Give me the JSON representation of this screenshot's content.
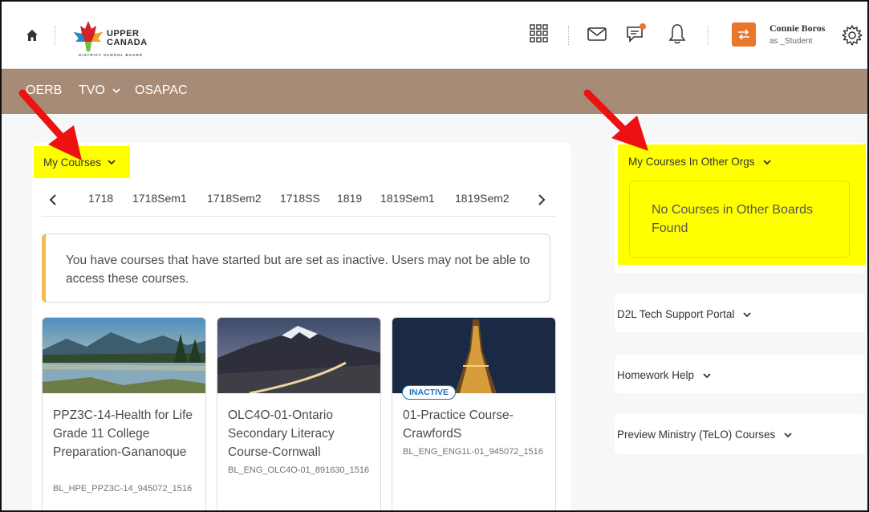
{
  "header": {
    "logo_line1": "UPPER",
    "logo_line2": "CANADA",
    "logo_line3": "DISTRICT SCHOOL BOARD",
    "user_name": "Connie Boros",
    "user_role": "as _Student",
    "icons": [
      "home-icon",
      "apps-grid-icon",
      "mail-icon",
      "chat-icon",
      "bell-icon",
      "impersonate-icon",
      "gear-icon"
    ],
    "chat_badge_color": "#e8762b"
  },
  "nav": {
    "items": [
      "OERB",
      "TVO",
      "OSAPAC"
    ],
    "bg_color": "#a68b76"
  },
  "my_courses": {
    "title": "My Courses",
    "tabs": [
      "1718",
      "1718Sem1",
      "1718Sem2",
      "1718SS",
      "1819",
      "1819Sem1",
      "1819Sem2"
    ],
    "alert": "You have courses that have started but are set as inactive. Users may not be able to access these courses.",
    "courses": [
      {
        "title": "PPZ3C-14-Health for Life Grade 11 College Preparation-Gananoque",
        "code": "BL_HPE_PPZ3C-14_945072_1516",
        "badge": ""
      },
      {
        "title": "OLC4O-01-Ontario Secondary Literacy Course-Cornwall",
        "code": "BL_ENG_OLC4O-01_891630_1516",
        "badge": ""
      },
      {
        "title": "01-Practice Course-CrawfordS",
        "code": "BL_ENG_ENG1L-01_945072_1516",
        "badge": "INACTIVE"
      }
    ]
  },
  "other_orgs": {
    "title": "My Courses In Other Orgs",
    "empty_message": "No Courses in Other Boards Found"
  },
  "widgets": [
    {
      "title": "D2L Tech Support Portal"
    },
    {
      "title": "Homework Help"
    },
    {
      "title": "Preview Ministry (TeLO) Courses"
    }
  ],
  "highlight_color": "#ffff00",
  "annotation_arrow_color": "#ee1111"
}
